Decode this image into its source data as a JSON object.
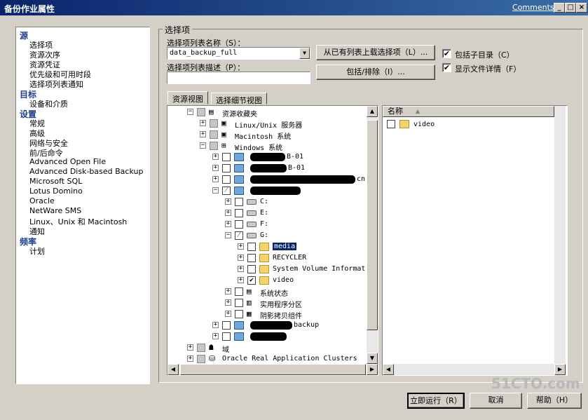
{
  "window": {
    "title": "备份作业属性",
    "comments_link": "Comments?",
    "controls": [
      "_",
      "□",
      "×"
    ]
  },
  "nav": {
    "categories": [
      {
        "label": "源",
        "items": [
          "选择项",
          "资源次序",
          "资源凭证",
          "优先级和可用时段",
          "选择项列表通知"
        ]
      },
      {
        "label": "目标",
        "items": [
          "设备和介质"
        ]
      },
      {
        "label": "设置",
        "items": [
          "常规",
          "高级",
          "网络与安全",
          "前/后命令",
          "Advanced Open File",
          "Advanced Disk-based Backup",
          "Microsoft SQL",
          "Lotus Domino",
          "Oracle",
          "NetWare SMS",
          "Linux、Unix 和 Macintosh",
          "通知"
        ]
      },
      {
        "label": "频率",
        "items": [
          "计划"
        ]
      }
    ],
    "selected": "选择项"
  },
  "selection": {
    "group_label": "选择项",
    "list_name_label": "选择项列表名称（S）：",
    "list_name_value": "data_backup_full",
    "list_desc_label": "选择项列表描述（P）：",
    "list_desc_value": "",
    "load_button": "从已有列表上载选择项（L）...",
    "include_button": "包括/排除（I）...",
    "include_subdirs_label": "包括子目录（C）",
    "include_subdirs_checked": true,
    "show_file_details_label": "显示文件详情（F）",
    "show_file_details_checked": true
  },
  "tabs": [
    "资源视图",
    "选择细节视图"
  ],
  "tree": [
    {
      "label": "资源收藏夹",
      "state": "gray",
      "exp": "-",
      "icon": "favorites-icon"
    },
    {
      "label": "Linux/Unix 服务器",
      "state": "gray",
      "exp": "+",
      "icon": "server-icon"
    },
    {
      "label": "Macintosh 系统",
      "state": "gray",
      "exp": "+",
      "icon": "server-icon"
    },
    {
      "label": "Windows 系统",
      "state": "gray",
      "exp": "-",
      "icon": "windows-icon"
    },
    {
      "label": "B-01",
      "state": "empty",
      "exp": "+",
      "icon": "computer-icon"
    },
    {
      "label": "B-01",
      "state": "empty",
      "exp": "+",
      "icon": "computer-icon"
    },
    {
      "label": "cn",
      "state": "empty",
      "exp": "+",
      "icon": "computer-icon"
    },
    {
      "label": "",
      "state": "partial",
      "exp": "-",
      "icon": "computer-icon"
    },
    {
      "label": "C:",
      "state": "empty",
      "exp": "+",
      "icon": "disk-icon"
    },
    {
      "label": "E:",
      "state": "empty",
      "exp": "+",
      "icon": "disk-icon"
    },
    {
      "label": "F:",
      "state": "empty",
      "exp": "+",
      "icon": "disk-icon"
    },
    {
      "label": "G:",
      "state": "partial",
      "exp": "-",
      "icon": "disk-icon"
    },
    {
      "label": "media",
      "state": "empty",
      "exp": "+",
      "icon": "folder-icon",
      "selected": true
    },
    {
      "label": "RECYCLER",
      "state": "empty",
      "exp": "+",
      "icon": "folder-icon"
    },
    {
      "label": "System Volume Informat",
      "state": "empty",
      "exp": "+",
      "icon": "folder-icon"
    },
    {
      "label": "video",
      "state": "checked",
      "exp": "+",
      "icon": "folder-icon"
    },
    {
      "label": "系统状态",
      "state": "empty",
      "exp": "+",
      "icon": "system-state-icon"
    },
    {
      "label": "实用程序分区",
      "state": "empty",
      "exp": "+",
      "icon": "partition-icon"
    },
    {
      "label": "阴影拷贝组件",
      "state": "empty",
      "exp": "+",
      "icon": "shadow-copy-icon"
    },
    {
      "label": "backup",
      "state": "empty",
      "exp": "+",
      "icon": "computer-icon"
    },
    {
      "label": "",
      "state": "empty",
      "exp": "+",
      "icon": "computer-icon"
    },
    {
      "label": "域",
      "state": "gray",
      "exp": "+",
      "icon": "domain-icon"
    },
    {
      "label": "Oracle Real Application Clusters",
      "state": "gray",
      "exp": "+",
      "icon": "database-icon"
    }
  ],
  "details": {
    "column": "名称",
    "items": [
      {
        "label": "video",
        "checked": false
      }
    ]
  },
  "footer": {
    "run_now": "立即运行（R）",
    "cancel": "取消",
    "help": "帮助（H）"
  },
  "watermark": "51CTO.com"
}
